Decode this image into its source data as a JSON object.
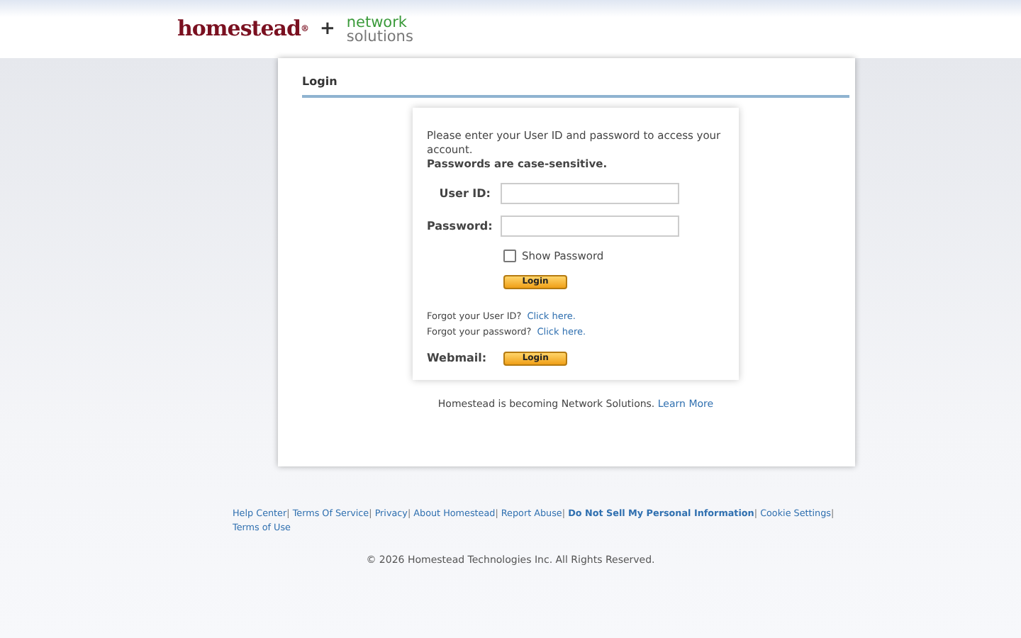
{
  "header": {
    "brand": "homestead",
    "brand_mark": "®",
    "plus": "+",
    "partner_line_1": "network",
    "partner_line_2": "solutions"
  },
  "panel": {
    "title": "Login"
  },
  "login": {
    "intro": "Please enter your User ID and password to access your account.",
    "notice": "Passwords are case-sensitive.",
    "fields": [
      {
        "label": "User ID:"
      },
      {
        "label": "Password:"
      }
    ],
    "show_password": {
      "label": "Show Password",
      "checked": false
    },
    "login_button": "Login",
    "help": [
      {
        "text": "Forgot your User ID?",
        "link": "Click here."
      },
      {
        "text": "Forgot your password?",
        "link": "Click here."
      }
    ],
    "webmail": {
      "label": "Webmail:",
      "button": "Login"
    }
  },
  "notice": {
    "text": "Homestead is becoming Network Solutions.",
    "link": "Learn More"
  },
  "footer": {
    "links": [
      {
        "label": "Help Center",
        "bold": false,
        "separator": "|"
      },
      {
        "label": "Terms Of Service",
        "bold": false,
        "separator": "|"
      },
      {
        "label": "Privacy",
        "bold": false,
        "separator": "|"
      },
      {
        "label": "About Homestead",
        "bold": false,
        "separator": "|"
      },
      {
        "label": "Report Abuse",
        "bold": false,
        "separator": "|"
      },
      {
        "label": "Do Not Sell My Personal Information",
        "bold": true,
        "separator": "|"
      },
      {
        "label": "Cookie Settings",
        "bold": false,
        "separator": "|"
      },
      {
        "label": "Terms of Use",
        "bold": false
      }
    ],
    "copyright": "© 2026 Homestead Technologies Inc. All Rights Reserved."
  }
}
